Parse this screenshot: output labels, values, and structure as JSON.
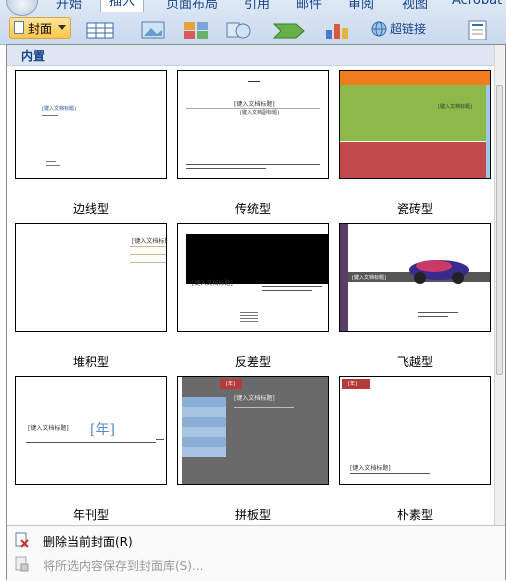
{
  "ribbon": {
    "tabs": [
      "开始",
      "插入",
      "页面布局",
      "引用",
      "邮件",
      "审阅",
      "视图",
      "Acrobat"
    ],
    "active_tab_index": 1,
    "cover_button": "封面",
    "hyperlink": "超链接"
  },
  "gallery": {
    "section_header": "内置",
    "covers": [
      {
        "name": "边线型",
        "title": "[键入文档标题]"
      },
      {
        "name": "传统型",
        "title": "[键入文档标题]",
        "subtitle": "[键入文档副标题]"
      },
      {
        "name": "瓷砖型",
        "title": "[键入文档标题]"
      },
      {
        "name": "堆积型",
        "title": "[键入文档标题]"
      },
      {
        "name": "反差型",
        "title": "[键入文档标题]"
      },
      {
        "name": "飞越型",
        "title": "[键入文档标题]"
      },
      {
        "name": "年刊型",
        "title": "[键入文档标题]",
        "year": "[年]"
      },
      {
        "name": "拼板型",
        "title": "[键入文档标题]",
        "year": "[年]"
      },
      {
        "name": "朴素型",
        "title": "[键入文档标题]",
        "year": "[年]"
      }
    ]
  },
  "menu": {
    "remove_cover": "删除当前封面(R)",
    "save_selection": "将所选内容保存到封面库(S)..."
  },
  "colors": {
    "tile_green": "#8db84a",
    "tile_red": "#c24a4a",
    "tile_orange": "#f07c1c",
    "contrast_black": "#000000",
    "flyby_purple": "#5a3e68",
    "panel_gray": "#6a6a6a",
    "accent_red": "#b73a3a"
  }
}
